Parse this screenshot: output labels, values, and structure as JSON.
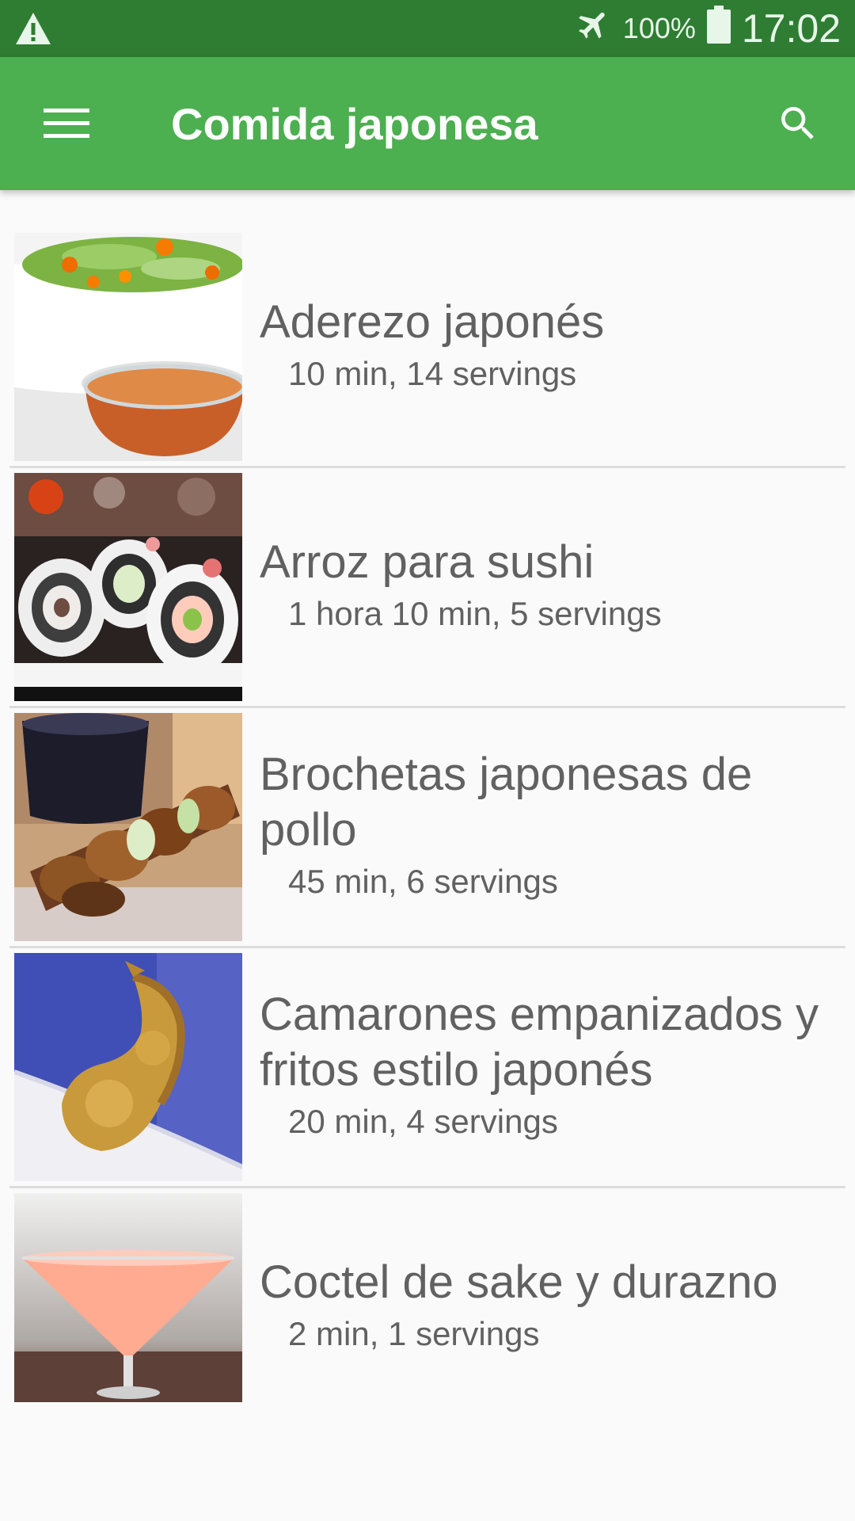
{
  "status_bar": {
    "warning_icon": "warning-triangle-icon",
    "airplane_icon": "airplane-icon",
    "battery_percent": "100%",
    "battery_icon": "battery-full-icon",
    "time": "17:02"
  },
  "app_bar": {
    "menu_icon": "hamburger-menu-icon",
    "title": "Comida japonesa",
    "search_icon": "search-icon",
    "color": "#4caf50",
    "status_color": "#2e7d32"
  },
  "recipes": [
    {
      "title": "Aderezo japonés",
      "meta": "10 min, 14 servings",
      "image": "salad-dressing-photo"
    },
    {
      "title": "Arroz para sushi",
      "meta": "1 hora 10 min, 5 servings",
      "image": "sushi-rolls-photo"
    },
    {
      "title": "Brochetas japonesas de pollo",
      "meta": "45 min, 6 servings",
      "image": "chicken-skewers-photo"
    },
    {
      "title": "Camarones empanizados y fritos estilo japonés",
      "meta": "20 min, 4 servings",
      "image": "fried-shrimp-photo"
    },
    {
      "title": "Coctel de sake y durazno",
      "meta": "2 min, 1 servings",
      "image": "peach-cocktail-photo"
    }
  ]
}
